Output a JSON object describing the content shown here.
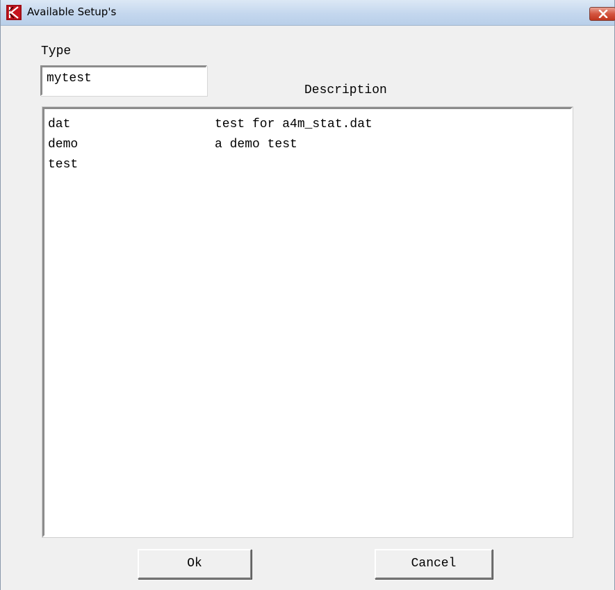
{
  "window": {
    "title": "Available Setup's",
    "icon": "k-logo-icon",
    "close_icon": "close-icon",
    "accent_color": "#c0361f"
  },
  "form": {
    "type_label": "Type",
    "type_value": "mytest",
    "description_label": "Description"
  },
  "list": {
    "rows": [
      {
        "name": "dat",
        "description": "test for a4m_stat.dat"
      },
      {
        "name": "demo",
        "description": "a demo test"
      },
      {
        "name": "test",
        "description": ""
      }
    ]
  },
  "buttons": {
    "ok_label": "Ok",
    "cancel_label": "Cancel"
  }
}
